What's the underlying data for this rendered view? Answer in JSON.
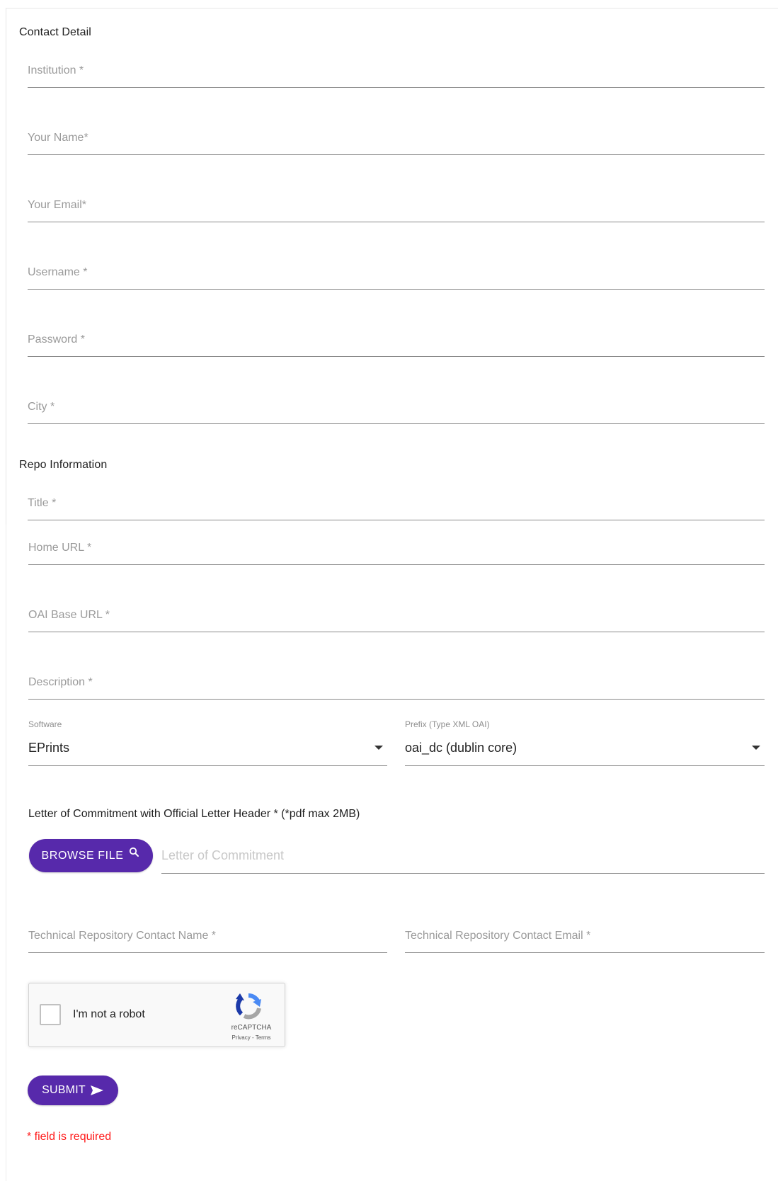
{
  "contact_section": {
    "title": "Contact Detail",
    "fields": {
      "institution": "Institution *",
      "your_name": "Your Name*",
      "your_email": "Your Email*",
      "username": "Username *",
      "password": "Password *",
      "city": "City *"
    }
  },
  "repo_section": {
    "title": "Repo Information",
    "fields": {
      "title": "Title *",
      "home_url": "Home URL *",
      "oai_base_url": "OAI Base URL *",
      "description": "Description *"
    },
    "software": {
      "label": "Software",
      "value": "EPrints"
    },
    "prefix": {
      "label": "Prefix (Type XML OAI)",
      "value": "oai_dc (dublin core)"
    },
    "letter": {
      "label": "Letter of Commitment with Official Letter Header * (*pdf max 2MB)",
      "browse_label": "BROWSE FILE",
      "placeholder": "Letter of Commitment"
    },
    "tech_contact_name": "Technical Repository Contact Name *",
    "tech_contact_email": "Technical Repository Contact Email *"
  },
  "captcha": {
    "text": "I'm not a robot",
    "brand": "reCAPTCHA",
    "privacy": "Privacy",
    "separator": " - ",
    "terms": "Terms"
  },
  "submit_label": "SUBMIT",
  "required_note": "* field is required",
  "colors": {
    "accent": "#5729ab",
    "required": "#ff1a1a",
    "placeholder": "#9a9a9a",
    "underline": "#8a8a8a"
  },
  "icons": {
    "browse": "search-icon",
    "submit": "send-icon",
    "dropdown": "caret-down-icon",
    "captcha": "recaptcha-logo-icon"
  }
}
